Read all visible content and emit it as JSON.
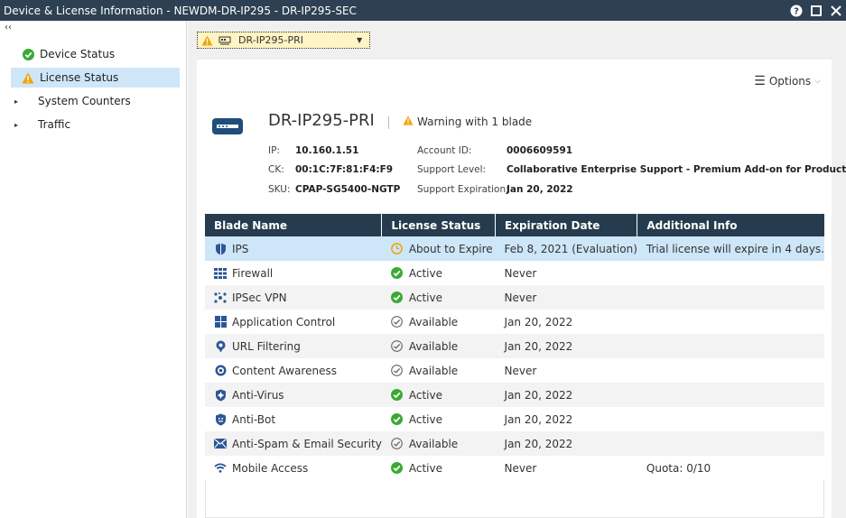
{
  "window": {
    "title": "Device & License Information - NEWDM-DR-IP295 - DR-IP295-SEC",
    "help_label": "?",
    "restore_label": "□",
    "close_label": "✕"
  },
  "sidebar": {
    "collapse_label": "‹‹",
    "items": [
      {
        "label": "Device Status",
        "icon": "check-icon"
      },
      {
        "label": "License Status",
        "icon": "warning-icon",
        "selected": true
      },
      {
        "label": "System Counters",
        "icon": "expand-arrow-icon"
      },
      {
        "label": "Traffic",
        "icon": "expand-arrow-icon"
      }
    ]
  },
  "device_selector": {
    "value": "DR-IP295-PRI"
  },
  "options_label": "Options",
  "device": {
    "name": "DR-IP295-PRI",
    "warning": "Warning with 1 blade",
    "ip_label": "IP:",
    "ip": "10.160.1.51",
    "ck_label": "CK:",
    "ck": "00:1C:7F:81:F4:F9",
    "sku_label": "SKU:",
    "sku": "CPAP-SG5400-NGTP",
    "account_label": "Account ID:",
    "account": "0006609591",
    "support_level_label": "Support Level:",
    "support_level": "Collaborative Enterprise Support - Premium Add-on for Products",
    "support_exp_label": "Support Expiration:",
    "support_exp": "Jan 20, 2022"
  },
  "table": {
    "headers": [
      "Blade Name",
      "License Status",
      "Expiration Date",
      "Additional Info"
    ],
    "rows": [
      {
        "name": "IPS",
        "status": "About to Expire",
        "expiration": "Feb 8, 2021 (Evaluation)",
        "info": "Trial license will expire in 4 days."
      },
      {
        "name": "Firewall",
        "status": "Active",
        "expiration": "Never",
        "info": ""
      },
      {
        "name": "IPSec VPN",
        "status": "Active",
        "expiration": "Never",
        "info": ""
      },
      {
        "name": "Application Control",
        "status": "Available",
        "expiration": "Jan 20, 2022",
        "info": ""
      },
      {
        "name": "URL Filtering",
        "status": "Available",
        "expiration": "Jan 20, 2022",
        "info": ""
      },
      {
        "name": "Content Awareness",
        "status": "Available",
        "expiration": "Never",
        "info": ""
      },
      {
        "name": "Anti-Virus",
        "status": "Active",
        "expiration": "Jan 20, 2022",
        "info": ""
      },
      {
        "name": "Anti-Bot",
        "status": "Active",
        "expiration": "Jan 20, 2022",
        "info": ""
      },
      {
        "name": "Anti-Spam & Email Security",
        "status": "Available",
        "expiration": "Jan 20, 2022",
        "info": ""
      },
      {
        "name": "Mobile Access",
        "status": "Active",
        "expiration": "Never",
        "info": "Quota: 0/10"
      }
    ]
  },
  "colors": {
    "titlebar": "#2d4152",
    "table_header": "#263c4e",
    "selection": "#cde6f8",
    "active_green": "#3aaa35",
    "warning_orange": "#f0a30a",
    "blade_icon_blue": "#2b5797"
  }
}
